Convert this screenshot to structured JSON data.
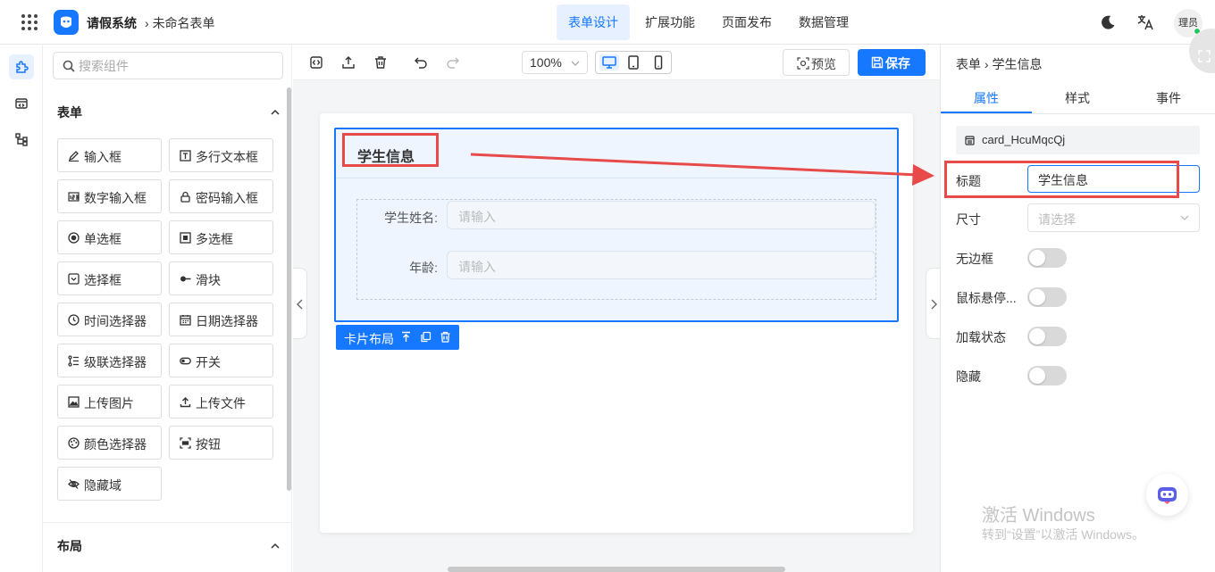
{
  "header": {
    "app_title": "请假系统",
    "breadcrumb": "未命名表单",
    "nav_tabs": [
      {
        "label": "表单设计",
        "active": true
      },
      {
        "label": "扩展功能",
        "active": false
      },
      {
        "label": "页面发布",
        "active": false
      },
      {
        "label": "数据管理",
        "active": false
      }
    ],
    "user_label": "理员",
    "accent_color": "#1677ff"
  },
  "sidebar": {
    "rail_icons": [
      "puzzle-icon",
      "code-icon",
      "tree-icon"
    ],
    "search_placeholder": "搜索组件",
    "sections": [
      {
        "title": "表单",
        "expanded": true
      },
      {
        "title": "布局",
        "expanded": true
      }
    ],
    "components": [
      {
        "label": "输入框",
        "icon": "pencil-icon"
      },
      {
        "label": "多行文本框",
        "icon": "text-area-icon"
      },
      {
        "label": "数字输入框",
        "icon": "number-icon"
      },
      {
        "label": "密码输入框",
        "icon": "lock-icon"
      },
      {
        "label": "单选框",
        "icon": "radio-icon"
      },
      {
        "label": "多选框",
        "icon": "checkbox-icon"
      },
      {
        "label": "选择框",
        "icon": "select-icon"
      },
      {
        "label": "滑块",
        "icon": "slider-icon"
      },
      {
        "label": "时间选择器",
        "icon": "clock-icon"
      },
      {
        "label": "日期选择器",
        "icon": "calendar-icon"
      },
      {
        "label": "级联选择器",
        "icon": "cascader-icon"
      },
      {
        "label": "开关",
        "icon": "switch-icon"
      },
      {
        "label": "上传图片",
        "icon": "image-icon"
      },
      {
        "label": "上传文件",
        "icon": "upload-icon"
      },
      {
        "label": "颜色选择器",
        "icon": "palette-icon"
      },
      {
        "label": "按钮",
        "icon": "button-icon"
      },
      {
        "label": "隐藏域",
        "icon": "eye-off-icon"
      }
    ]
  },
  "toolbar": {
    "zoom": "100%",
    "preview_label": "预览",
    "save_label": "保存"
  },
  "canvas": {
    "card_title": "学生信息",
    "fields": [
      {
        "label": "学生姓名:",
        "placeholder": "请输入"
      },
      {
        "label": "年龄:",
        "placeholder": "请输入"
      }
    ],
    "card_tag_label": "卡片布局"
  },
  "props": {
    "breadcrumb_root": "表单",
    "breadcrumb_leaf": "学生信息",
    "tabs": [
      {
        "label": "属性",
        "active": true
      },
      {
        "label": "样式",
        "active": false
      },
      {
        "label": "事件",
        "active": false
      }
    ],
    "component_id": "card_HcuMqcQj",
    "title_label": "标题",
    "title_value": "学生信息",
    "size_label": "尺寸",
    "size_placeholder": "请选择",
    "toggles": [
      {
        "label": "无边框",
        "on": false
      },
      {
        "label": "鼠标悬停...",
        "on": false
      },
      {
        "label": "加载状态",
        "on": false
      },
      {
        "label": "隐藏",
        "on": false
      }
    ]
  },
  "watermark": {
    "line1": "激活 Windows",
    "line2": "转到“设置”以激活 Windows。"
  }
}
